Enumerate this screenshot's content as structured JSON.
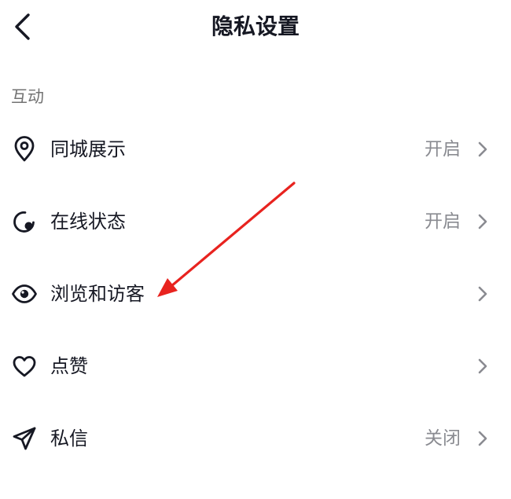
{
  "header": {
    "title": "隐私设置",
    "back_icon": "chevron-left-icon"
  },
  "section": {
    "label": "互动"
  },
  "rows": [
    {
      "label": "同城展示",
      "value": "开启",
      "icon": "location-pin-icon"
    },
    {
      "label": "在线状态",
      "value": "开启",
      "icon": "online-status-icon"
    },
    {
      "label": "浏览和访客",
      "value": "",
      "icon": "eye-icon"
    },
    {
      "label": "点赞",
      "value": "",
      "icon": "heart-icon"
    },
    {
      "label": "私信",
      "value": "关闭",
      "icon": "paper-plane-icon"
    }
  ],
  "colors": {
    "text_primary": "#161823",
    "text_secondary": "#8a8b91",
    "section_label": "#737373",
    "annotation_arrow": "#e8231f",
    "background": "#ffffff"
  }
}
